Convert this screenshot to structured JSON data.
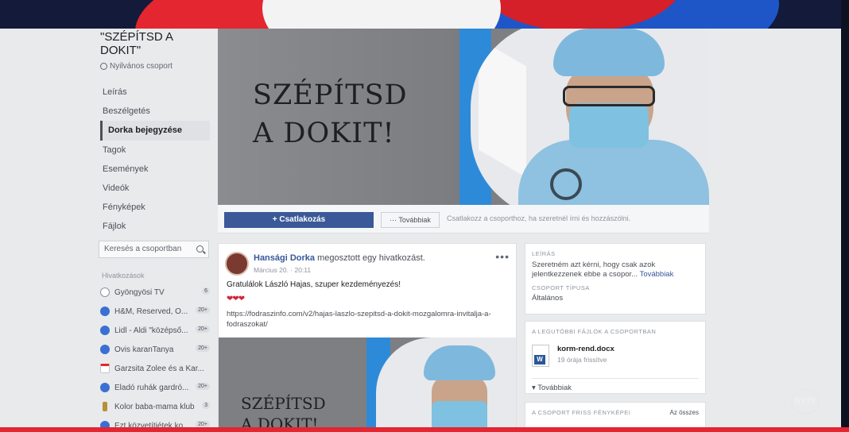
{
  "group": {
    "title": "\"SZÉPÍTSD A DOKIT\"",
    "privacy": "Nyilvános csoport"
  },
  "nav": [
    "Leírás",
    "Beszélgetés",
    "Dorka bejegyzése",
    "Tagok",
    "Események",
    "Videók",
    "Fényképek",
    "Fájlok"
  ],
  "search": {
    "placeholder": "Keresés a csoportban"
  },
  "shortcuts": {
    "heading": "Hivatkozások",
    "items": [
      {
        "label": "Gyöngyösi TV",
        "count": "6"
      },
      {
        "label": "H&M, Reserved, O...",
        "count": "20+"
      },
      {
        "label": "Lidl - Aldi \"középső...",
        "count": "20+"
      },
      {
        "label": "Ovis karanTanya",
        "count": "20+"
      },
      {
        "label": "Garzsita Zolee és a Kar...",
        "count": ""
      },
      {
        "label": "Eladó ruhák gardró...",
        "count": "20+"
      },
      {
        "label": "Kolor baba-mama klub",
        "count": "3"
      },
      {
        "label": "Ezt közvetítjétek ko...",
        "count": "20+"
      }
    ]
  },
  "cover": {
    "line1": "SZÉPÍTSD",
    "line2": "A DOKIT!"
  },
  "actions": {
    "join": "+ Csatlakozás",
    "more": "··· Továbbiak",
    "hint": "Csatlakozz a csoporthoz, ha szeretnél írni és hozzászólni."
  },
  "post": {
    "author": "Hansági Dorka",
    "action": " megosztott egy hivatkozást.",
    "date": "Március 20. · 20:11",
    "menu": "•••",
    "text": "Gratulálok László Hajas, szuper kezdeményezés!",
    "hearts": "❤❤❤",
    "link": "https://fodraszinfo.com/v2/hajas-laszlo-szepitsd-a-dokit-mozgalomra-invitalja-a-fodraszokat/",
    "image_line1": "SZÉPÍTSD",
    "image_line2": "A DOKIT!"
  },
  "about": {
    "heading": "Leírás",
    "text": "Szeretném azt kérni, hogy csak azok jelentkezzenek ebbe a csopor... ",
    "more": "Továbbiak",
    "type_heading": "Csoport típusa",
    "type": "Általános"
  },
  "files": {
    "heading": "A legutóbbi fájlok a csoportban",
    "name": "korm-rend.docx",
    "meta": "19 órája frissítve",
    "more": "▾  Továbbiak"
  },
  "photos": {
    "heading": "A csoport friss fényképei",
    "all": "Az összes"
  },
  "logo": "GYTV"
}
